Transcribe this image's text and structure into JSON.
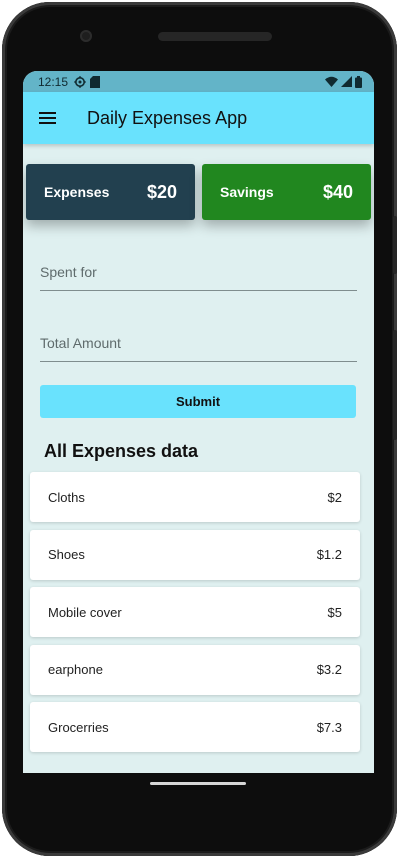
{
  "status_bar": {
    "time": "12:15"
  },
  "app_bar": {
    "title": "Daily Expenses App"
  },
  "summary": {
    "expenses": {
      "label": "Expenses",
      "value": "$20",
      "color": "#22404f"
    },
    "savings": {
      "label": "Savings",
      "value": "$40",
      "color": "#21871f"
    }
  },
  "form": {
    "spent_for_placeholder": "Spent for",
    "amount_placeholder": "Total Amount",
    "submit_label": "Submit"
  },
  "list": {
    "title": "All Expenses data",
    "items": [
      {
        "name": "Cloths",
        "amount": "$2"
      },
      {
        "name": "Shoes",
        "amount": "$1.2"
      },
      {
        "name": "Mobile cover",
        "amount": "$5"
      },
      {
        "name": "earphone",
        "amount": "$3.2"
      },
      {
        "name": "Grocerries",
        "amount": "$7.3"
      }
    ]
  },
  "colors": {
    "accent": "#69e2fd",
    "background": "#dff0f0"
  }
}
